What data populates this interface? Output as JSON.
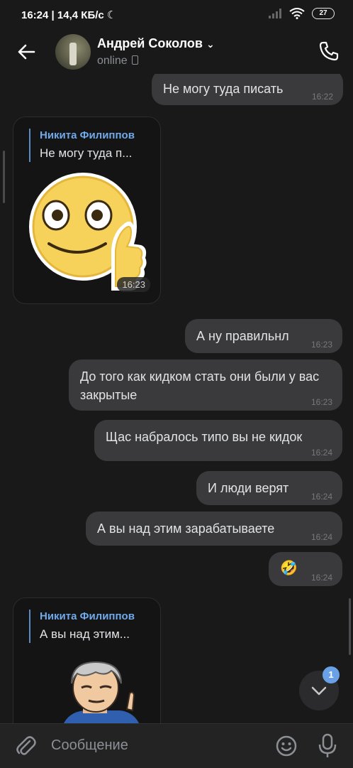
{
  "status_bar": {
    "time": "16:24",
    "speed": "14,4 КБ/с",
    "battery": "27"
  },
  "header": {
    "name": "Андрей Соколов",
    "status": "online"
  },
  "messages": {
    "m1": {
      "text": "Не могу туда писать",
      "time": "16:22"
    },
    "sticker1": {
      "reply_name": "Никита Филиппов",
      "reply_text": "Не могу туда п...",
      "time": "16:23"
    },
    "m2": {
      "text": "А ну правильнл",
      "time": "16:23"
    },
    "m3": {
      "text": "До того как кидком стать они были у вас закрытые",
      "time": "16:23"
    },
    "m4": {
      "text": "Щас набралось типо вы не кидок",
      "time": "16:24"
    },
    "m5": {
      "text": "И люди верят",
      "time": "16:24"
    },
    "m6": {
      "text": "А вы над этим зарабатываете",
      "time": "16:24"
    },
    "m7": {
      "text": "🤣",
      "time": "16:24"
    },
    "sticker2": {
      "reply_name": "Никита Филиппов",
      "reply_text": "А вы над этим..."
    }
  },
  "scroll_button": {
    "badge": "1"
  },
  "composer": {
    "placeholder": "Сообщение"
  },
  "colors": {
    "background": "#19191a",
    "bubble": "#3a3a3c",
    "accent": "#71aaeb",
    "badge": "#6aa1e6"
  }
}
